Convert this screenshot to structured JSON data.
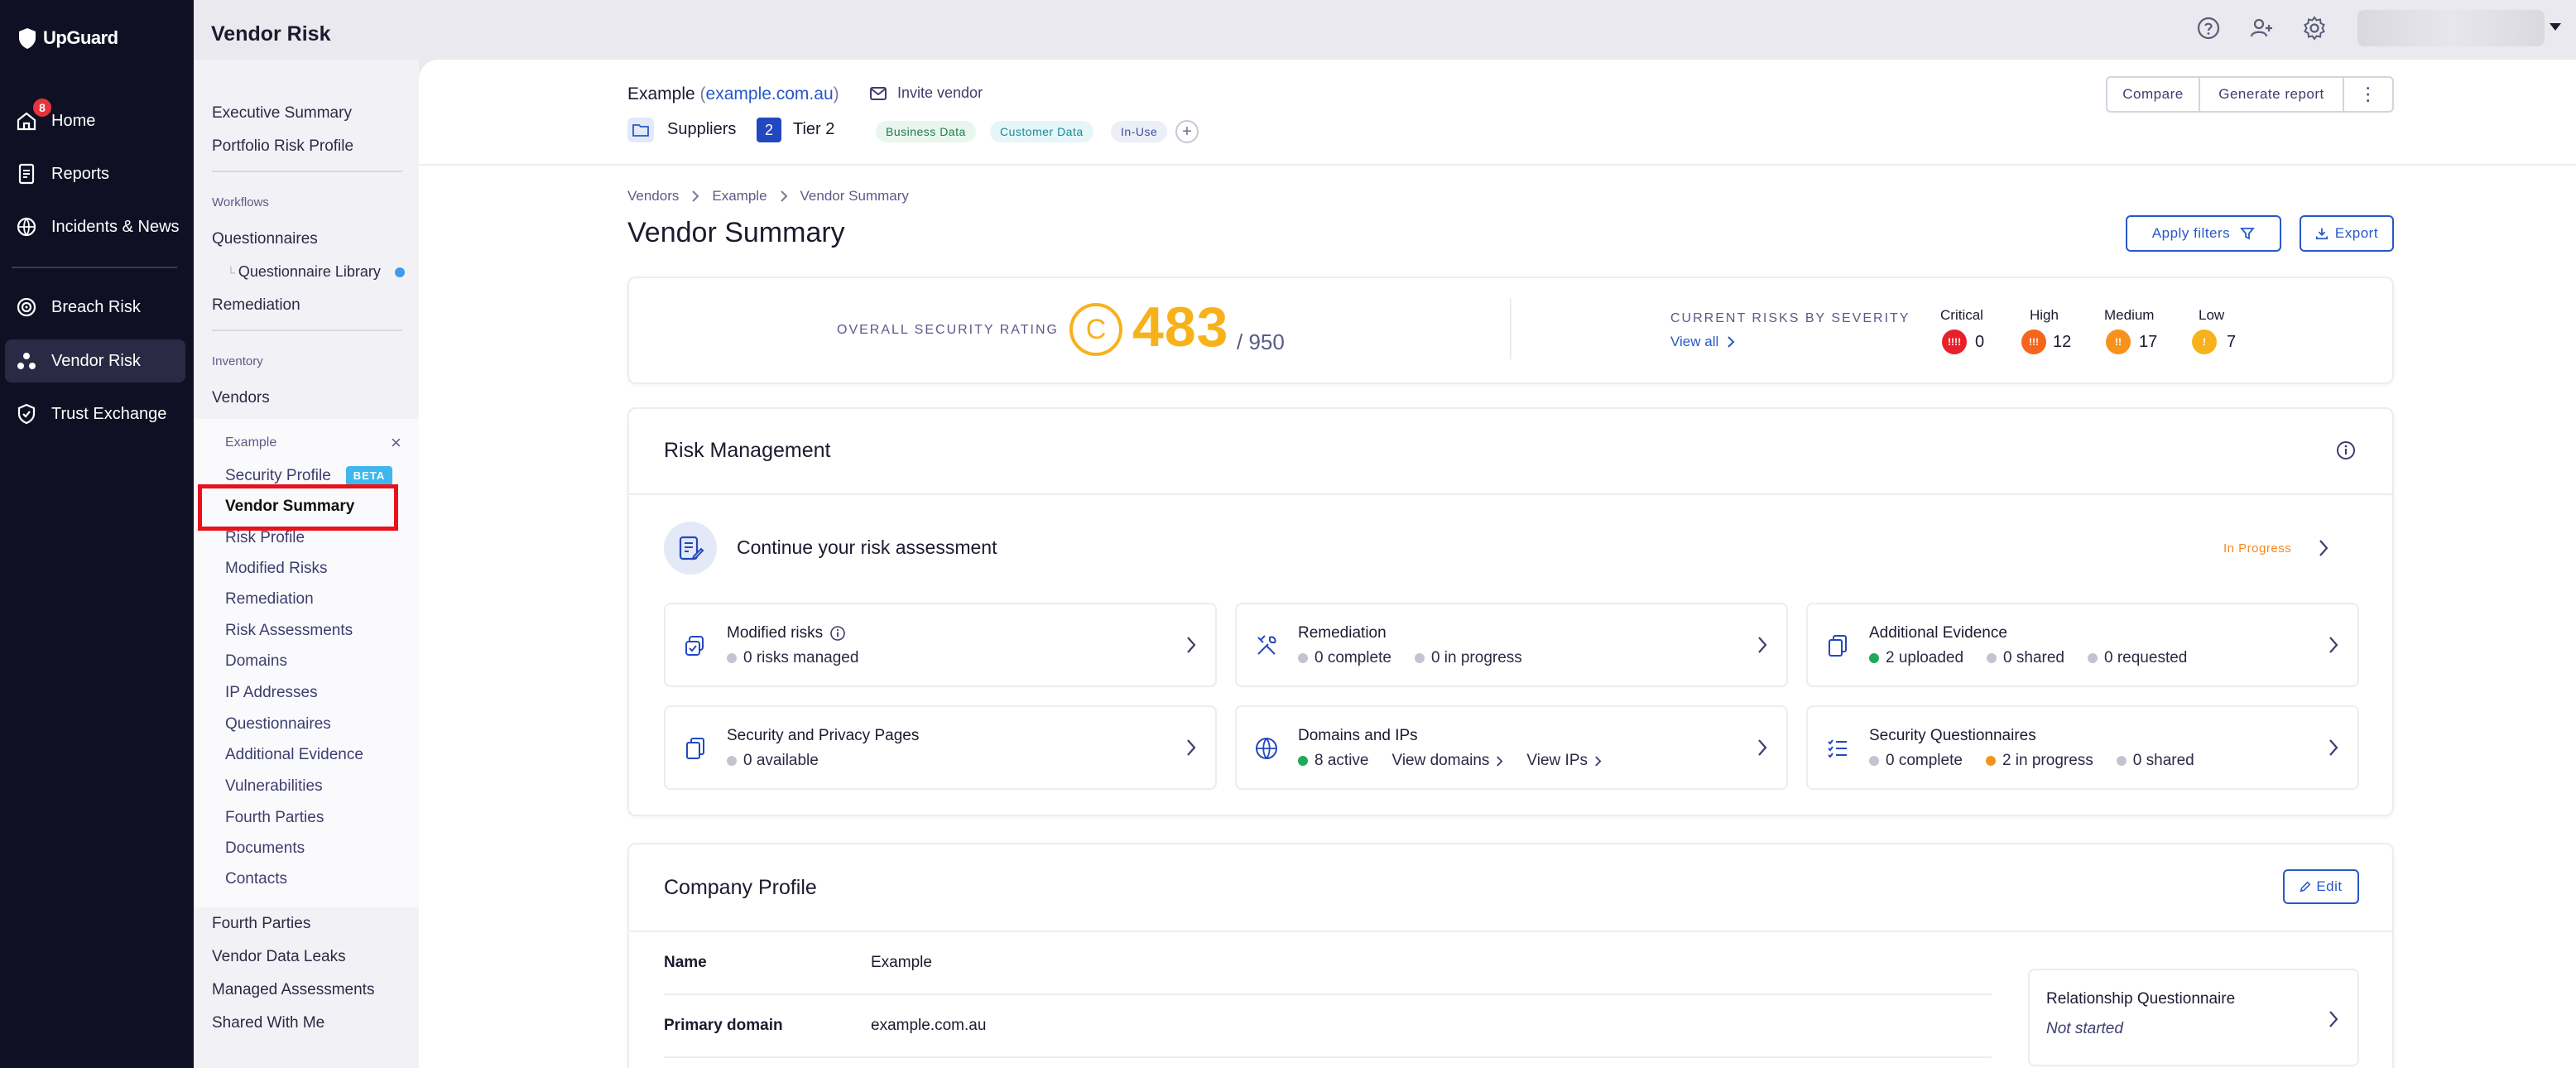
{
  "nav": {
    "logo": "UpGuard",
    "home_badge": "8",
    "items": [
      {
        "label": "Home",
        "icon": "home-icon"
      },
      {
        "label": "Reports",
        "icon": "reports-icon"
      },
      {
        "label": "Incidents & News",
        "icon": "incidents-icon"
      },
      {
        "label": "Breach Risk",
        "icon": "breach-risk-icon"
      },
      {
        "label": "Vendor Risk",
        "icon": "vendor-risk-icon"
      },
      {
        "label": "Trust Exchange",
        "icon": "trust-exchange-icon"
      }
    ]
  },
  "header": {
    "title": "Vendor Risk"
  },
  "subnav": {
    "executive_summary": "Executive Summary",
    "portfolio_risk_profile": "Portfolio Risk Profile",
    "workflows_head": "Workflows",
    "questionnaires": "Questionnaires",
    "questionnaire_library": "Questionnaire Library",
    "remediation": "Remediation",
    "inventory_head": "Inventory",
    "vendors": "Vendors",
    "vendor_panel": {
      "vendor_name": "Example",
      "close": "×",
      "beta": "BETA",
      "items": [
        "Security Profile",
        "Vendor Summary",
        "Risk Profile",
        "Modified Risks",
        "Remediation",
        "Risk Assessments",
        "Domains",
        "IP Addresses",
        "Questionnaires",
        "Additional Evidence",
        "Vulnerabilities",
        "Fourth Parties",
        "Documents",
        "Contacts"
      ]
    },
    "bottom": [
      "Fourth Parties",
      "Vendor Data Leaks",
      "Managed Assessments",
      "Shared With Me"
    ]
  },
  "vendor": {
    "name": "Example",
    "domain": "example.com.au",
    "open_paren": "(",
    "close_paren": ")",
    "invite": "Invite vendor",
    "folder": "Suppliers",
    "tier_num": "2",
    "tier_label": "Tier 2",
    "chips": [
      "Business Data",
      "Customer Data",
      "In-Use"
    ],
    "chip_plus": "+",
    "buttons": {
      "compare": "Compare",
      "generate": "Generate report",
      "more": "⋮"
    }
  },
  "page": {
    "breadcrumbs": [
      "Vendors",
      "Example",
      "Vendor Summary"
    ],
    "title": "Vendor Summary",
    "apply_filters": "Apply filters",
    "export": "Export"
  },
  "rating": {
    "label": "OVERALL SECURITY RATING",
    "grade": "C",
    "score": "483",
    "max": "/ 950",
    "risks_label": "CURRENT RISKS BY SEVERITY",
    "view_all": "View all",
    "severities": [
      {
        "label": "Critical",
        "glyph": "!!!!",
        "count": "0",
        "color": "#e8202a"
      },
      {
        "label": "High",
        "glyph": "!!!",
        "count": "12",
        "color": "#f7641b"
      },
      {
        "label": "Medium",
        "glyph": "!!",
        "count": "17",
        "color": "#f7921b"
      },
      {
        "label": "Low",
        "glyph": "!",
        "count": "7",
        "color": "#f7b21b"
      }
    ]
  },
  "risk_mgmt": {
    "title": "Risk Management",
    "assessment": "Continue your risk assessment",
    "status": "In Progress",
    "tiles": [
      {
        "title": "Modified risks",
        "meta": [
          {
            "dot": "#c4c4d0",
            "text": "0 risks managed"
          }
        ]
      },
      {
        "title": "Remediation",
        "meta": [
          {
            "dot": "#c4c4d0",
            "text": "0 complete"
          },
          {
            "dot": "#c4c4d0",
            "text": "0 in progress"
          }
        ]
      },
      {
        "title": "Additional Evidence",
        "meta": [
          {
            "dot": "#22a85a",
            "text": "2 uploaded"
          },
          {
            "dot": "#c4c4d0",
            "text": "0 shared"
          },
          {
            "dot": "#c4c4d0",
            "text": "0 requested"
          }
        ]
      },
      {
        "title": "Security and Privacy Pages",
        "meta": [
          {
            "dot": "#c4c4d0",
            "text": "0 available"
          }
        ]
      },
      {
        "title": "Domains and IPs",
        "meta": [
          {
            "dot": "#22a85a",
            "text": "8 active"
          }
        ],
        "links": [
          "View domains",
          "View IPs"
        ]
      },
      {
        "title": "Security Questionnaires",
        "meta": [
          {
            "dot": "#c4c4d0",
            "text": "0 complete"
          },
          {
            "dot": "#f7921b",
            "text": "2 in progress"
          },
          {
            "dot": "#c4c4d0",
            "text": "0 shared"
          }
        ]
      }
    ]
  },
  "company": {
    "title": "Company Profile",
    "edit": "Edit",
    "rows": [
      {
        "label": "Name",
        "value": "Example"
      },
      {
        "label": "Primary domain",
        "value": "example.com.au"
      }
    ],
    "rq_title": "Relationship Questionnaire",
    "rq_status": "Not started"
  }
}
